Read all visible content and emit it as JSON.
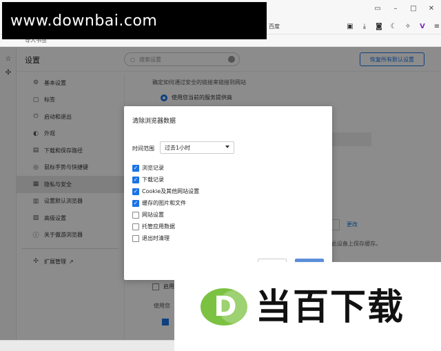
{
  "browser": {
    "address_text": "百度",
    "bookmark_label": "导入书签"
  },
  "settings": {
    "title": "设置",
    "search_placeholder": "搜索设置",
    "reset_button": "恢复所有默认设置",
    "nav": [
      {
        "label": "基本设置",
        "icon": "gear-icon"
      },
      {
        "label": "标签",
        "icon": "tab-icon"
      },
      {
        "label": "启动和退出",
        "icon": "power-icon"
      },
      {
        "label": "外观",
        "icon": "palette-icon"
      },
      {
        "label": "下载和保存路径",
        "icon": "folder-icon"
      },
      {
        "label": "鼠标手势与快捷键",
        "icon": "mouse-icon"
      },
      {
        "label": "隐私与安全",
        "icon": "lock-icon"
      },
      {
        "label": "设置默认浏览器",
        "icon": "browser-icon"
      },
      {
        "label": "高级设置",
        "icon": "advanced-icon"
      },
      {
        "label": "关于傲游浏览器",
        "icon": "info-icon"
      }
    ],
    "extensions_label": "扩展管理",
    "content": {
      "line1": "确定如何通过安全的链接来链接到网站",
      "radio_label": "使用您当前的服务提供商",
      "change_link": "更改",
      "cache_text": "此设备上保存缓存。",
      "app_label": "启用",
      "row5": "使用您"
    }
  },
  "dialog": {
    "title": "清除浏览器数据",
    "time_range_label": "时间范围",
    "time_range_value": "过去1小时",
    "options": [
      {
        "label": "浏览记录",
        "checked": true
      },
      {
        "label": "下载记录",
        "checked": true
      },
      {
        "label": "Cookie及其他网站设置",
        "checked": true
      },
      {
        "label": "缓存的图片和文件",
        "checked": true
      },
      {
        "label": "网站设置",
        "checked": false
      },
      {
        "label": "托管应用数据",
        "checked": false
      },
      {
        "label": "退出时清理",
        "checked": false
      }
    ]
  },
  "watermark": {
    "top_url": "www.downbai.com",
    "logo_letter": "D",
    "brand_text": "当百下载"
  },
  "colors": {
    "accent": "#1a73e8",
    "logo_green": "#7cc242"
  }
}
